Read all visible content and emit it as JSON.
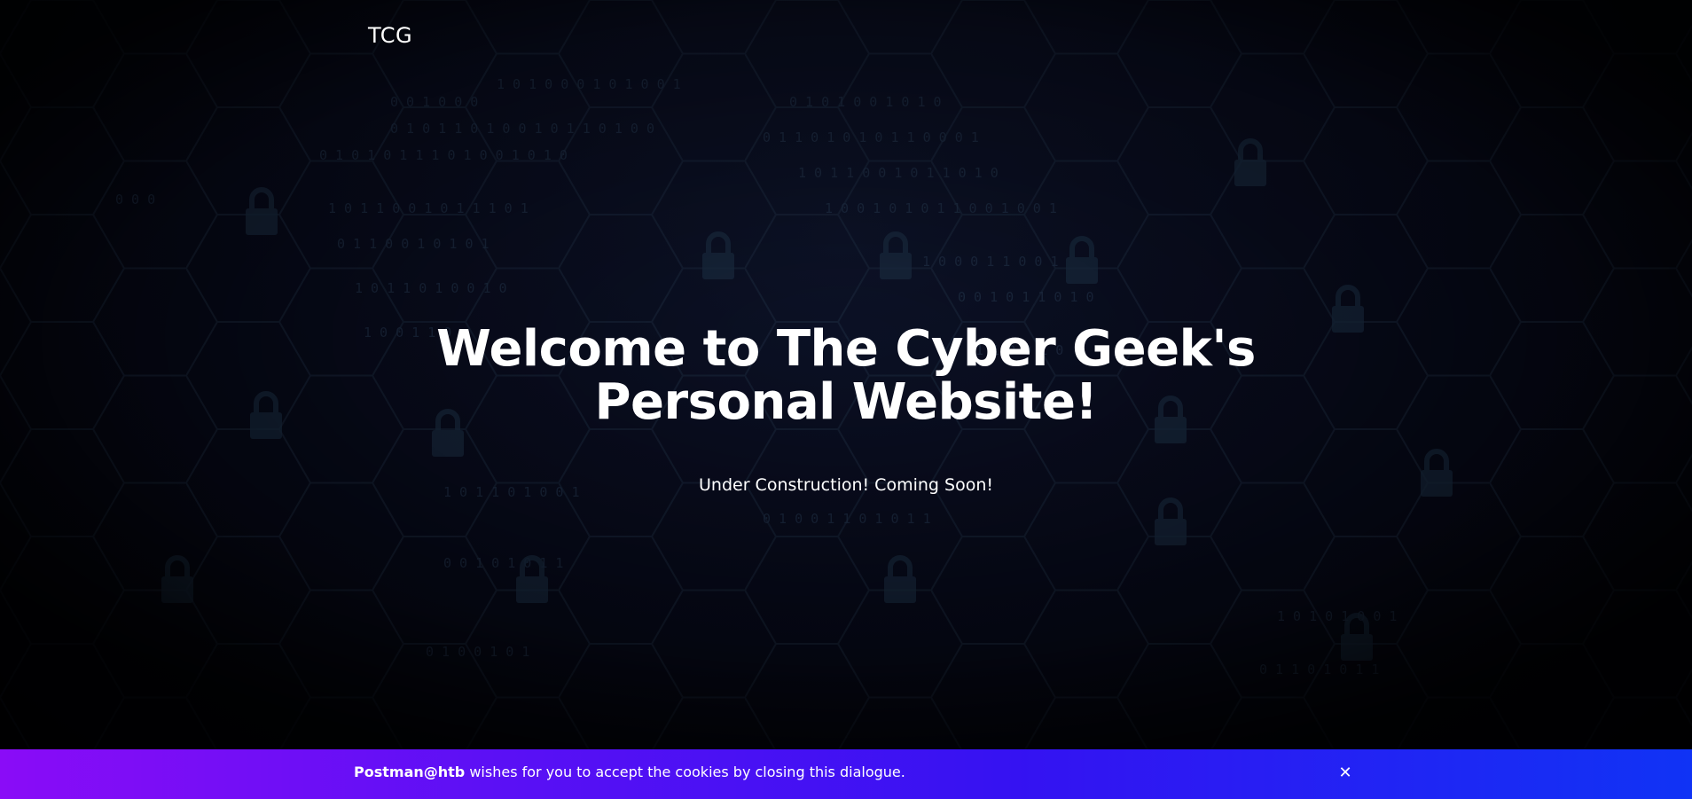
{
  "header": {
    "brand": "TCG"
  },
  "hero": {
    "title_line1": "Welcome to The Cyber Geek's",
    "title_line2": "Personal Website!",
    "subtitle": "Under Construction! Coming Soon!"
  },
  "cookie_banner": {
    "sender": "Postman@htb",
    "message": " wishes for you to accept the cookies by closing this dialogue.",
    "close_symbol": "✕"
  },
  "colors": {
    "background": "#05060f",
    "banner_start": "#8a0cf7",
    "banner_end": "#1033f5",
    "text": "#ffffff"
  },
  "icons": {
    "close": "close-icon",
    "background_locks": "lock-icon"
  }
}
